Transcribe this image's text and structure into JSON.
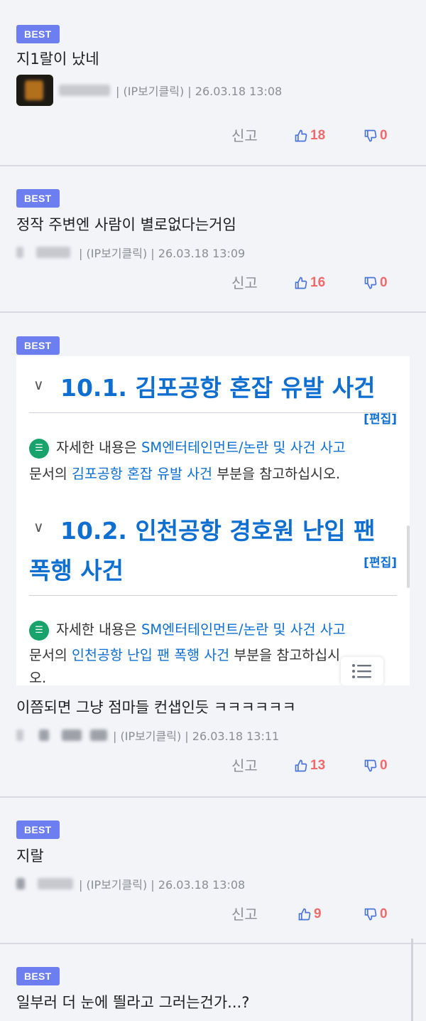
{
  "comments": [
    {
      "badge": "BEST",
      "text": "지1랄이 났네",
      "meta": "| (IP보기클릭) | 26.03.18 13:08",
      "report": "신고",
      "likes": "18",
      "dislikes": "0"
    },
    {
      "badge": "BEST",
      "text": "정작 주변엔 사람이 별로없다는거임",
      "meta": "| (IP보기클릭) | 26.03.18 13:09",
      "report": "신고",
      "likes": "16",
      "dislikes": "0"
    },
    {
      "badge": "BEST",
      "text": "이쯤되면 그냥 점마들 컨샙인듯 ㅋㅋㅋㅋㅋㅋ",
      "meta": "| (IP보기클릭) | 26.03.18 13:11",
      "report": "신고",
      "likes": "13",
      "dislikes": "0"
    },
    {
      "badge": "BEST",
      "text": "지랄",
      "meta": "| (IP보기클릭) | 26.03.18 13:08",
      "report": "신고",
      "likes": "9",
      "dislikes": "0"
    },
    {
      "badge": "BEST",
      "text": "일부러 더 눈에 띌라고 그러는건가...?"
    }
  ],
  "wiki": {
    "section1_title": "10.1. 김포공항 혼잡 유발 사건",
    "section2_title_line1": "10.2. 인천공항 경호원 난입 팬",
    "section2_title_line2": "폭행 사건",
    "edit_label": "[편집]",
    "note_icon": "memo-icon",
    "note1_prefix": "자세한 내용은 ",
    "note1_link": "SM엔터테인먼트/논란 및 사건 사고",
    "note1_line2_prefix": "문서의 ",
    "note1_line2_link": "김포공항 혼잡 유발 사건",
    "note1_line2_suffix": " 부분을 참고하십시오.",
    "note2_prefix": "자세한 내용은 ",
    "note2_link": "SM엔터테인먼트/논란 및 사건 사고",
    "note2_line2_prefix": "문서의 ",
    "note2_line2_link": "인천공항 난입 팬 폭행 사건",
    "note2_line2_suffix": " 부분을 참고하십시",
    "note2_line3": "오."
  },
  "colors": {
    "badge": "#6d7ff0",
    "like": "#ef6a6a",
    "wiki_link": "#0f6fd0",
    "background": "#f3f4f8"
  }
}
